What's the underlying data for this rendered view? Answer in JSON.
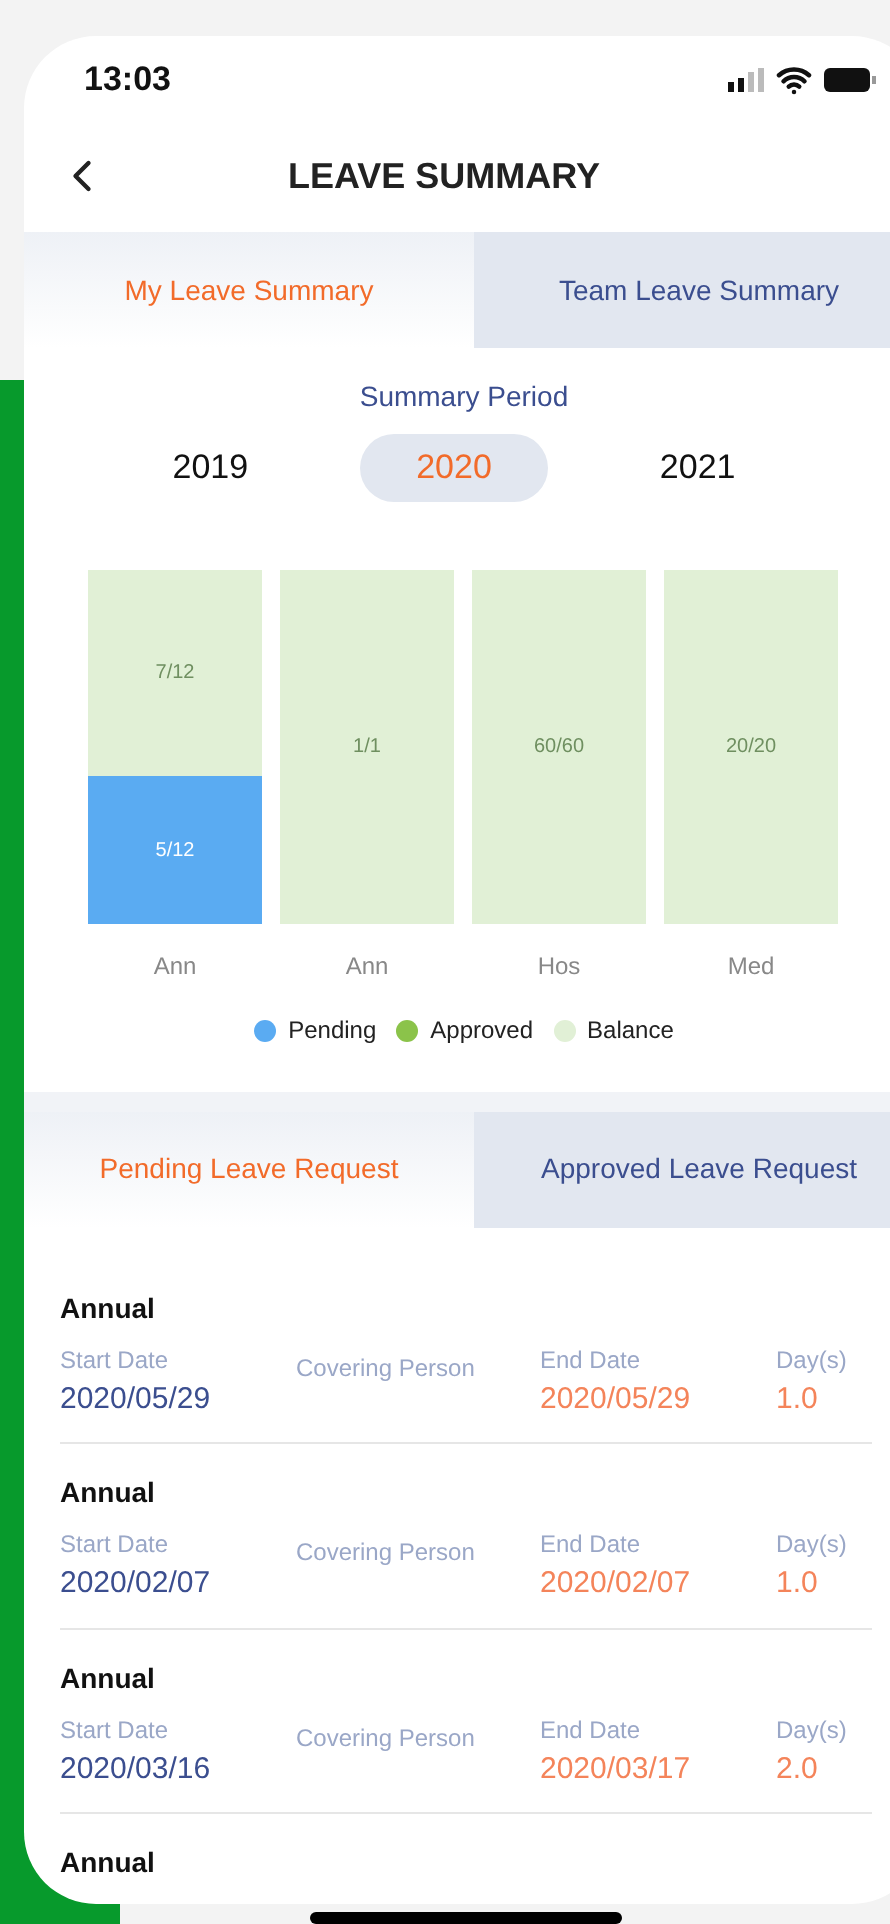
{
  "status_bar": {
    "time": "13:03"
  },
  "header": {
    "title": "LEAVE SUMMARY"
  },
  "summary_tabs": [
    {
      "label": "My Leave Summary",
      "selected": true
    },
    {
      "label": "Team Leave Summary",
      "selected": false
    }
  ],
  "period": {
    "label": "Summary Period",
    "years": [
      {
        "label": "2019",
        "selected": false
      },
      {
        "label": "2020",
        "selected": true
      },
      {
        "label": "2021",
        "selected": false
      }
    ]
  },
  "bars": [
    {
      "label": "Ann",
      "balance_text": "7/12",
      "pending_text": "5/12",
      "level": 0.417
    },
    {
      "label": "Ann",
      "balance_text": "1/1"
    },
    {
      "label": "Hos",
      "balance_text": "60/60"
    },
    {
      "label": "Med",
      "balance_text": "20/20"
    }
  ],
  "legend": [
    {
      "label": "Pending",
      "color": "#5aabf2"
    },
    {
      "label": "Approved",
      "color": "#8bc34a"
    },
    {
      "label": "Balance",
      "color": "#e1f0d6"
    }
  ],
  "request_tabs": [
    {
      "label": "Pending Leave Request",
      "selected": true
    },
    {
      "label": "Approved Leave Request",
      "selected": false
    }
  ],
  "requests": [
    {
      "type": "Annual",
      "start_label": "Start Date",
      "start": "2020/05/29",
      "covering_label": "Covering Person",
      "end_label": "End Date",
      "end": "2020/05/29",
      "days_label": "Day(s)",
      "days": "1.0"
    },
    {
      "type": "Annual",
      "start_label": "Start Date",
      "start": "2020/02/07",
      "covering_label": "Covering Person",
      "end_label": "End Date",
      "end": "2020/02/07",
      "days_label": "Day(s)",
      "days": "1.0"
    },
    {
      "type": "Annual",
      "start_label": "Start Date",
      "start": "2020/03/16",
      "covering_label": "Covering Person",
      "end_label": "End Date",
      "end": "2020/03/17",
      "days_label": "Day(s)",
      "days": "2.0"
    },
    {
      "type": "Annual"
    }
  ]
}
